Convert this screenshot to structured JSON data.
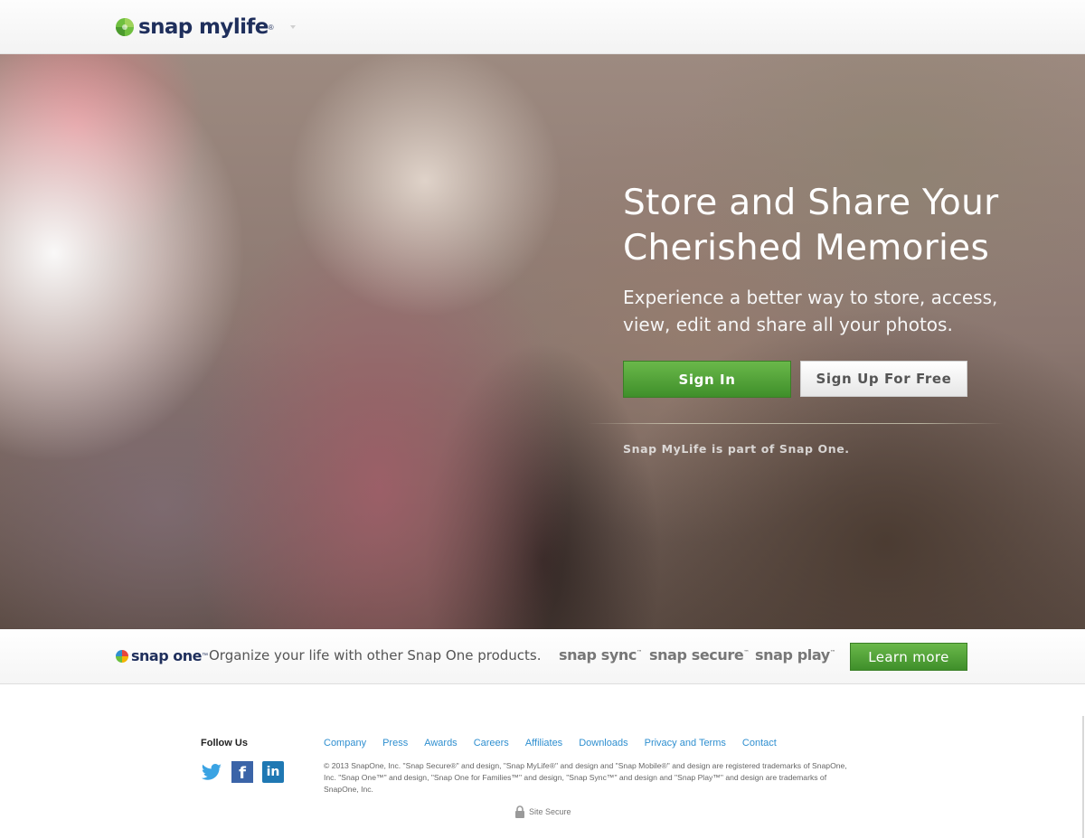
{
  "header": {
    "logo_text": "snap mylife",
    "logo_reg": "®"
  },
  "hero": {
    "title": "Store and Share Your\nCherished Memories",
    "subtitle": "Experience a better way to store, access,\nview, edit and share all your photos.",
    "signin_label": "Sign In",
    "signup_label": "Sign Up For Free",
    "note": "Snap MyLife is part of Snap One."
  },
  "snapone_bar": {
    "logo_text": "snap one",
    "logo_tm": "™",
    "tagline": "Organize your life with other Snap One products.",
    "products": [
      {
        "label": "snap sync",
        "tm": "™"
      },
      {
        "label": "snap secure",
        "tm": "™"
      },
      {
        "label": "snap play",
        "tm": "™"
      }
    ],
    "learn_more_label": "Learn more"
  },
  "footer": {
    "follow_title": "Follow Us",
    "social": [
      {
        "icon": "twitter-icon"
      },
      {
        "icon": "facebook-icon",
        "glyph": "f"
      },
      {
        "icon": "linkedin-icon",
        "glyph": "in"
      }
    ],
    "links": [
      "Company",
      "Press",
      "Awards",
      "Careers",
      "Affiliates",
      "Downloads",
      "Privacy and Terms",
      "Contact"
    ],
    "legal": "© 2013 SnapOne, Inc. \"Snap Secure®\" and design, \"Snap MyLife®\" and design and \"Snap Mobile®\" and design are registered trademarks of SnapOne, Inc. \"Snap One™\" and design, \"Snap One for Families™\" and design, \"Snap Sync™\" and design and \"Snap Play™\" and design are trademarks of SnapOne, Inc.",
    "secure_text": "Site Secure"
  },
  "colors": {
    "brand_navy": "#1f2f5c",
    "accent_green": "#4fa336",
    "link_blue": "#2f8fd0"
  }
}
